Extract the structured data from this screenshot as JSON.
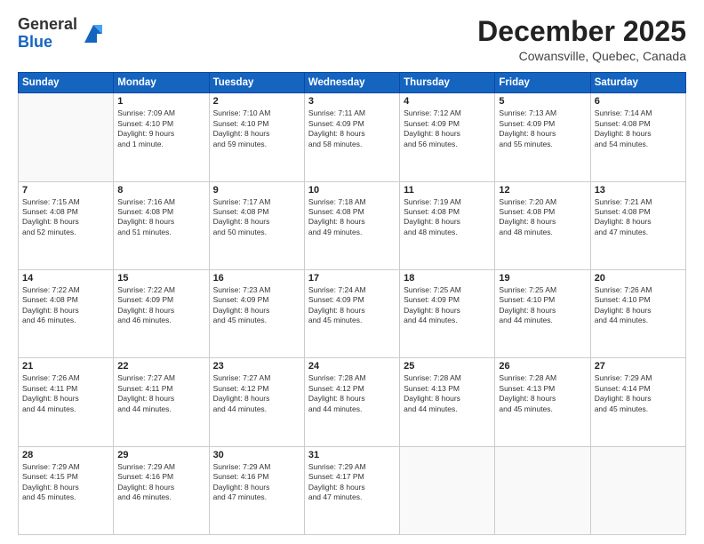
{
  "header": {
    "logo_general": "General",
    "logo_blue": "Blue",
    "month": "December 2025",
    "location": "Cowansville, Quebec, Canada"
  },
  "weekdays": [
    "Sunday",
    "Monday",
    "Tuesday",
    "Wednesday",
    "Thursday",
    "Friday",
    "Saturday"
  ],
  "weeks": [
    [
      {
        "day": "",
        "info": ""
      },
      {
        "day": "1",
        "info": "Sunrise: 7:09 AM\nSunset: 4:10 PM\nDaylight: 9 hours\nand 1 minute."
      },
      {
        "day": "2",
        "info": "Sunrise: 7:10 AM\nSunset: 4:10 PM\nDaylight: 8 hours\nand 59 minutes."
      },
      {
        "day": "3",
        "info": "Sunrise: 7:11 AM\nSunset: 4:09 PM\nDaylight: 8 hours\nand 58 minutes."
      },
      {
        "day": "4",
        "info": "Sunrise: 7:12 AM\nSunset: 4:09 PM\nDaylight: 8 hours\nand 56 minutes."
      },
      {
        "day": "5",
        "info": "Sunrise: 7:13 AM\nSunset: 4:09 PM\nDaylight: 8 hours\nand 55 minutes."
      },
      {
        "day": "6",
        "info": "Sunrise: 7:14 AM\nSunset: 4:08 PM\nDaylight: 8 hours\nand 54 minutes."
      }
    ],
    [
      {
        "day": "7",
        "info": "Sunrise: 7:15 AM\nSunset: 4:08 PM\nDaylight: 8 hours\nand 52 minutes."
      },
      {
        "day": "8",
        "info": "Sunrise: 7:16 AM\nSunset: 4:08 PM\nDaylight: 8 hours\nand 51 minutes."
      },
      {
        "day": "9",
        "info": "Sunrise: 7:17 AM\nSunset: 4:08 PM\nDaylight: 8 hours\nand 50 minutes."
      },
      {
        "day": "10",
        "info": "Sunrise: 7:18 AM\nSunset: 4:08 PM\nDaylight: 8 hours\nand 49 minutes."
      },
      {
        "day": "11",
        "info": "Sunrise: 7:19 AM\nSunset: 4:08 PM\nDaylight: 8 hours\nand 48 minutes."
      },
      {
        "day": "12",
        "info": "Sunrise: 7:20 AM\nSunset: 4:08 PM\nDaylight: 8 hours\nand 48 minutes."
      },
      {
        "day": "13",
        "info": "Sunrise: 7:21 AM\nSunset: 4:08 PM\nDaylight: 8 hours\nand 47 minutes."
      }
    ],
    [
      {
        "day": "14",
        "info": "Sunrise: 7:22 AM\nSunset: 4:08 PM\nDaylight: 8 hours\nand 46 minutes."
      },
      {
        "day": "15",
        "info": "Sunrise: 7:22 AM\nSunset: 4:09 PM\nDaylight: 8 hours\nand 46 minutes."
      },
      {
        "day": "16",
        "info": "Sunrise: 7:23 AM\nSunset: 4:09 PM\nDaylight: 8 hours\nand 45 minutes."
      },
      {
        "day": "17",
        "info": "Sunrise: 7:24 AM\nSunset: 4:09 PM\nDaylight: 8 hours\nand 45 minutes."
      },
      {
        "day": "18",
        "info": "Sunrise: 7:25 AM\nSunset: 4:09 PM\nDaylight: 8 hours\nand 44 minutes."
      },
      {
        "day": "19",
        "info": "Sunrise: 7:25 AM\nSunset: 4:10 PM\nDaylight: 8 hours\nand 44 minutes."
      },
      {
        "day": "20",
        "info": "Sunrise: 7:26 AM\nSunset: 4:10 PM\nDaylight: 8 hours\nand 44 minutes."
      }
    ],
    [
      {
        "day": "21",
        "info": "Sunrise: 7:26 AM\nSunset: 4:11 PM\nDaylight: 8 hours\nand 44 minutes."
      },
      {
        "day": "22",
        "info": "Sunrise: 7:27 AM\nSunset: 4:11 PM\nDaylight: 8 hours\nand 44 minutes."
      },
      {
        "day": "23",
        "info": "Sunrise: 7:27 AM\nSunset: 4:12 PM\nDaylight: 8 hours\nand 44 minutes."
      },
      {
        "day": "24",
        "info": "Sunrise: 7:28 AM\nSunset: 4:12 PM\nDaylight: 8 hours\nand 44 minutes."
      },
      {
        "day": "25",
        "info": "Sunrise: 7:28 AM\nSunset: 4:13 PM\nDaylight: 8 hours\nand 44 minutes."
      },
      {
        "day": "26",
        "info": "Sunrise: 7:28 AM\nSunset: 4:13 PM\nDaylight: 8 hours\nand 45 minutes."
      },
      {
        "day": "27",
        "info": "Sunrise: 7:29 AM\nSunset: 4:14 PM\nDaylight: 8 hours\nand 45 minutes."
      }
    ],
    [
      {
        "day": "28",
        "info": "Sunrise: 7:29 AM\nSunset: 4:15 PM\nDaylight: 8 hours\nand 45 minutes."
      },
      {
        "day": "29",
        "info": "Sunrise: 7:29 AM\nSunset: 4:16 PM\nDaylight: 8 hours\nand 46 minutes."
      },
      {
        "day": "30",
        "info": "Sunrise: 7:29 AM\nSunset: 4:16 PM\nDaylight: 8 hours\nand 47 minutes."
      },
      {
        "day": "31",
        "info": "Sunrise: 7:29 AM\nSunset: 4:17 PM\nDaylight: 8 hours\nand 47 minutes."
      },
      {
        "day": "",
        "info": ""
      },
      {
        "day": "",
        "info": ""
      },
      {
        "day": "",
        "info": ""
      }
    ]
  ]
}
